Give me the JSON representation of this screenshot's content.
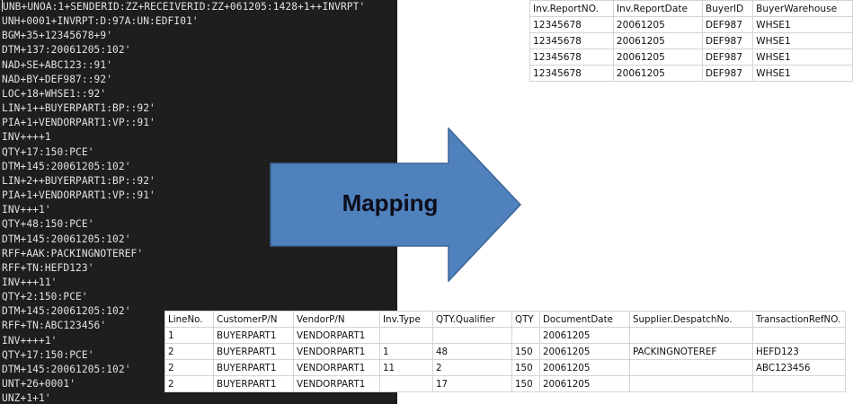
{
  "edi_message": [
    "UNB+UNOA:1+SENDERID:ZZ+RECEIVERID:ZZ+061205:1428+1++INVRPT'",
    "UNH+0001+INVRPT:D:97A:UN:EDFI01'",
    "BGM+35+12345678+9'",
    "DTM+137:20061205:102'",
    "NAD+SE+ABC123::91'",
    "NAD+BY+DEF987::92'",
    "LOC+18+WHSE1::92'",
    "LIN+1++BUYERPART1:BP::92'",
    "PIA+1+VENDORPART1:VP::91'",
    "INV++++1",
    "QTY+17:150:PCE'",
    "DTM+145:20061205:102'",
    "LIN+2++BUYERPART1:BP::92'",
    "PIA+1+VENDORPART1:VP::91'",
    "INV+++1'",
    "QTY+48:150:PCE'",
    "DTM+145:20061205:102'",
    "RFF+AAK:PACKINGNOTEREF'",
    "RFF+TN:HEFD123'",
    "INV+++11'",
    "QTY+2:150:PCE'",
    "DTM+145:20061205:102'",
    "RFF+TN:ABC123456'",
    "INV++++1'",
    "QTY+17:150:PCE'",
    "DTM+145:20061205:102'",
    "UNT+26+0001'",
    "UNZ+1+1'"
  ],
  "arrow": {
    "label": "Mapping",
    "color": "#4f81bd"
  },
  "header_table": {
    "columns": [
      "Inv.ReportNO.",
      "Inv.ReportDate",
      "BuyerID",
      "BuyerWarehouse"
    ],
    "rows": [
      [
        "12345678",
        "20061205",
        "DEF987",
        "WHSE1"
      ],
      [
        "12345678",
        "20061205",
        "DEF987",
        "WHSE1"
      ],
      [
        "12345678",
        "20061205",
        "DEF987",
        "WHSE1"
      ],
      [
        "12345678",
        "20061205",
        "DEF987",
        "WHSE1"
      ]
    ]
  },
  "detail_table": {
    "columns": [
      "LineNo.",
      "CustomerP/N",
      "VendorP/N",
      "Inv.Type",
      "QTY.Qualifier",
      "QTY",
      "DocumentDate",
      "Supplier.DespatchNo.",
      "TransactionRefNO."
    ],
    "rows": [
      [
        "1",
        "BUYERPART1",
        "VENDORPART1",
        "",
        "",
        "",
        "20061205",
        "",
        ""
      ],
      [
        "2",
        "BUYERPART1",
        "VENDORPART1",
        "1",
        "48",
        "150",
        "20061205",
        "PACKINGNOTEREF",
        "HEFD123"
      ],
      [
        "2",
        "BUYERPART1",
        "VENDORPART1",
        "11",
        "2",
        "150",
        "20061205",
        "",
        "ABC123456"
      ],
      [
        "2",
        "BUYERPART1",
        "VENDORPART1",
        "",
        "17",
        "150",
        "20061205",
        "",
        ""
      ]
    ]
  }
}
